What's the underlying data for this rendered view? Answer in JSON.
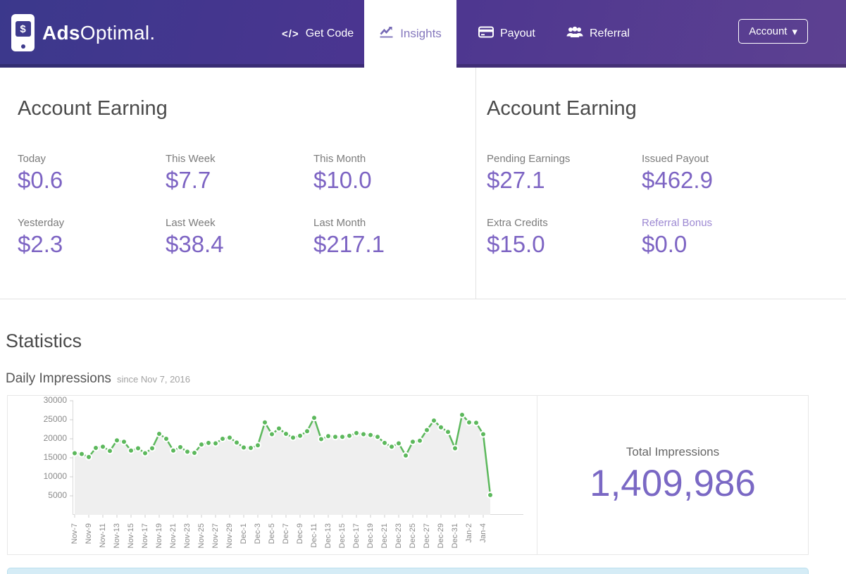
{
  "brand": {
    "logo_symbol": "$",
    "bold": "Ads",
    "rest": "Optimal."
  },
  "nav": {
    "get_code_icon_glyph": "</>",
    "items": [
      {
        "label": "Get Code"
      },
      {
        "label": "Insights",
        "active": true
      },
      {
        "label": "Payout"
      },
      {
        "label": "Referral"
      }
    ],
    "account_label": "Account",
    "account_caret": "▾"
  },
  "earnings_left": {
    "title": "Account Earning",
    "stats": [
      {
        "label": "Today",
        "value": "$0.6"
      },
      {
        "label": "This Week",
        "value": "$7.7"
      },
      {
        "label": "This Month",
        "value": "$10.0"
      },
      {
        "label": "Yesterday",
        "value": "$2.3"
      },
      {
        "label": "Last Week",
        "value": "$38.4"
      },
      {
        "label": "Last Month",
        "value": "$217.1"
      }
    ]
  },
  "earnings_right": {
    "title": "Account Earning",
    "stats": [
      {
        "label": "Pending Earnings",
        "value": "$27.1"
      },
      {
        "label": "Issued Payout",
        "value": "$462.9"
      },
      {
        "label": "Extra Credits",
        "value": "$15.0"
      },
      {
        "label": "Referral Bonus",
        "value": "$0.0",
        "highlight": true
      }
    ]
  },
  "statistics": {
    "title": "Statistics",
    "chart_title": "Daily Impressions",
    "chart_subtitle": "since Nov 7, 2016",
    "total_label": "Total Impressions",
    "total_value": "1,409,986",
    "chart_data": {
      "type": "area",
      "title": "Daily Impressions",
      "xlabel": "",
      "ylabel": "",
      "ylim": [
        0,
        30000
      ],
      "yticks": [
        5000,
        10000,
        15000,
        20000,
        25000,
        30000
      ],
      "x_tick_every": 2,
      "grid": false,
      "legend": "none",
      "line_color": "#5cb85c",
      "point_color": "#5cb85c",
      "fill_color": "#efefef",
      "categories": [
        "Nov-7",
        "Nov-8",
        "Nov-9",
        "Nov-10",
        "Nov-11",
        "Nov-12",
        "Nov-13",
        "Nov-14",
        "Nov-15",
        "Nov-16",
        "Nov-17",
        "Nov-18",
        "Nov-19",
        "Nov-20",
        "Nov-21",
        "Nov-22",
        "Nov-23",
        "Nov-24",
        "Nov-25",
        "Nov-26",
        "Nov-27",
        "Nov-28",
        "Nov-29",
        "Nov-30",
        "Dec-1",
        "Dec-2",
        "Dec-3",
        "Dec-4",
        "Dec-5",
        "Dec-6",
        "Dec-7",
        "Dec-8",
        "Dec-9",
        "Dec-10",
        "Dec-11",
        "Dec-12",
        "Dec-13",
        "Dec-14",
        "Dec-15",
        "Dec-16",
        "Dec-17",
        "Dec-18",
        "Dec-19",
        "Dec-20",
        "Dec-21",
        "Dec-22",
        "Dec-23",
        "Dec-24",
        "Dec-25",
        "Dec-26",
        "Dec-27",
        "Dec-28",
        "Dec-29",
        "Dec-30",
        "Dec-31",
        "Jan-1",
        "Jan-2",
        "Jan-3",
        "Jan-4",
        "Jan-5"
      ],
      "values": [
        16200,
        16000,
        15200,
        17600,
        17900,
        16800,
        19600,
        19200,
        16900,
        17500,
        16200,
        17500,
        21300,
        20000,
        16900,
        17800,
        16600,
        16300,
        18500,
        18900,
        18800,
        20000,
        20300,
        19000,
        17700,
        17600,
        18300,
        24300,
        21200,
        22700,
        21300,
        20300,
        20800,
        22000,
        25500,
        19900,
        20700,
        20500,
        20500,
        20800,
        21500,
        21200,
        21000,
        20500,
        18900,
        17900,
        18800,
        15600,
        19200,
        19500,
        22300,
        24800,
        23000,
        21800,
        17500,
        26300,
        24300,
        24200,
        21200,
        5200
      ]
    }
  },
  "colors": {
    "accent_purple": "#7d64c3",
    "header_gradient_start": "#3b388c",
    "header_gradient_end": "#5d4191",
    "chart_green": "#5cb85c",
    "alert_blue": "#d5ecf6"
  }
}
